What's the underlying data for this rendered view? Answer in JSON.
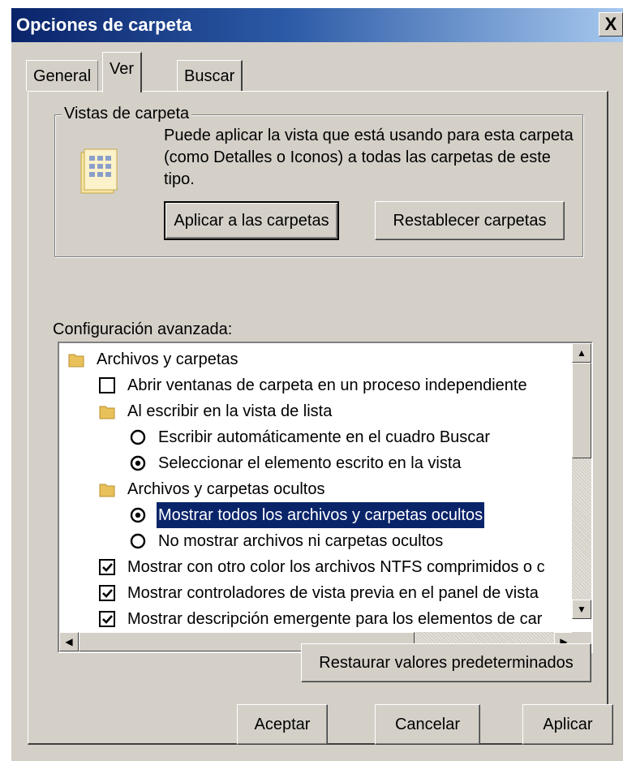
{
  "window": {
    "title": "Opciones de carpeta",
    "close_glyph": "X"
  },
  "tabs": [
    {
      "label": "General"
    },
    {
      "label": "Ver",
      "selected": true
    },
    {
      "label": "Buscar"
    }
  ],
  "folder_views": {
    "legend": "Vistas de carpeta",
    "description": "Puede aplicar la vista que está usando para esta carpeta (como Detalles o Iconos) a todas las carpetas de este tipo.",
    "apply_button": "Aplicar a las carpetas",
    "reset_button": "Restablecer carpetas",
    "icon": "folder-view-icon"
  },
  "advanced": {
    "label": "Configuración avanzada:",
    "items": [
      {
        "type": "folder",
        "text": "Archivos y carpetas"
      },
      {
        "type": "checkbox",
        "checked": false,
        "text": "Abrir ventanas de carpeta  en un proceso independiente"
      },
      {
        "type": "folder",
        "text": "Al escribir en la vista de lista"
      },
      {
        "type": "radio",
        "checked": false,
        "text": "Escribir automáticamente en el cuadro Buscar"
      },
      {
        "type": "radio",
        "checked": true,
        "text": "Seleccionar el elemento escrito en la vista"
      },
      {
        "type": "folder",
        "text": "Archivos y carpetas ocultos"
      },
      {
        "type": "radio",
        "checked": true,
        "selected": true,
        "text": "Mostrar todos los archivos y carpetas ocultos"
      },
      {
        "type": "radio",
        "checked": false,
        "text": "No mostrar archivos ni carpetas ocultos"
      },
      {
        "type": "checkbox",
        "checked": true,
        "text": "Mostrar con otro color los archivos NTFS comprimidos o c"
      },
      {
        "type": "checkbox",
        "checked": true,
        "text": "Mostrar controladores de vista previa en el panel de vista"
      },
      {
        "type": "checkbox",
        "checked": true,
        "text": "Mostrar descripción emergente para los elementos de car"
      }
    ]
  },
  "buttons": {
    "restore": "Restaurar valores predeterminados",
    "ok": "Aceptar",
    "cancel": "Cancelar",
    "apply": "Aplicar"
  },
  "colors": {
    "selection": "#0a246a",
    "dialog_bg": "#d4d0c8",
    "folder_yellow": "#e8c15a"
  }
}
